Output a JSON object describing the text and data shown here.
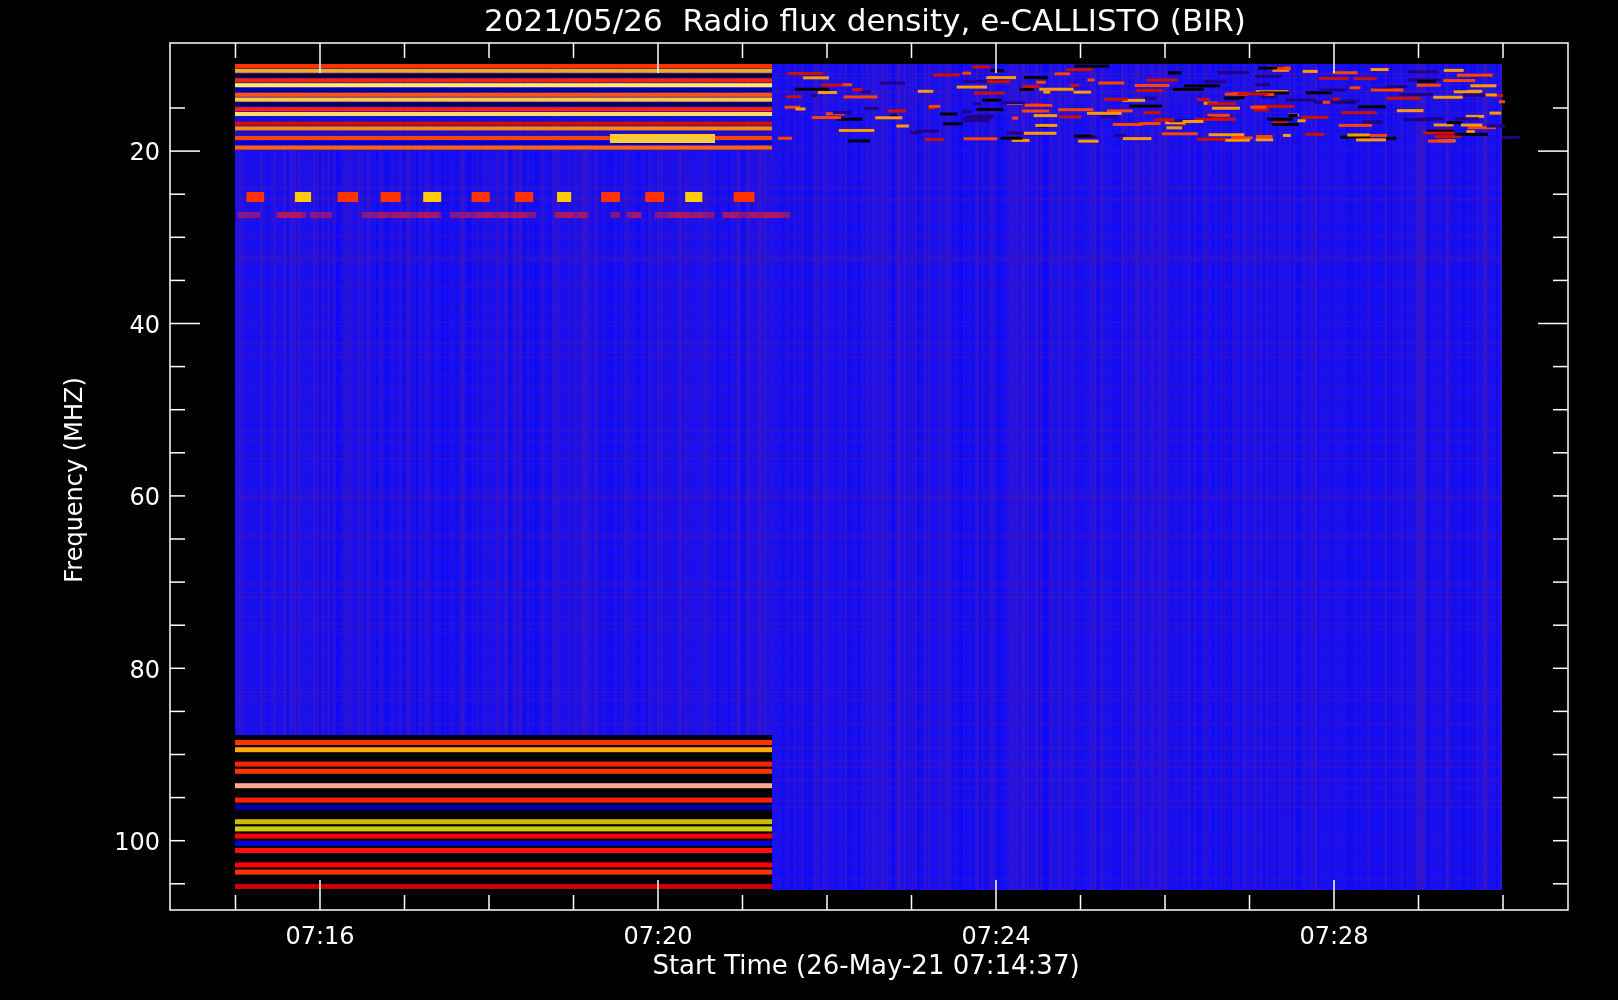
{
  "title": "2021/05/26  Radio flux density, e-CALLISTO (BIR)",
  "y_axis": {
    "label": "Frequency (MHZ)",
    "ticks": [
      "20",
      "40",
      "60",
      "80",
      "100"
    ]
  },
  "x_axis": {
    "label": "Start Time (26-May-21 07:14:37)",
    "ticks": [
      "07:16",
      "07:20",
      "07:24",
      "07:28"
    ]
  }
}
